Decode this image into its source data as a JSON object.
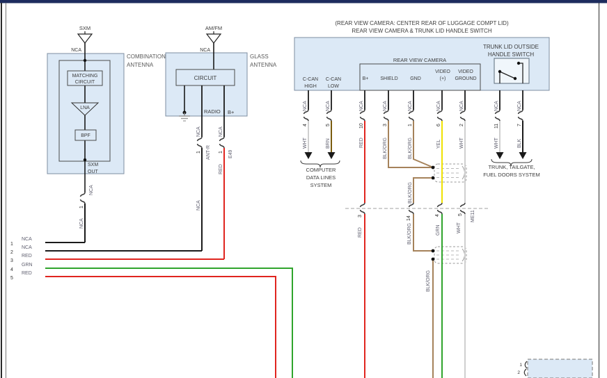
{
  "header": {
    "line1": "(REAR VIEW CAMERA: CENTER REAR OF LUGGAGE COMPT LID)",
    "line2": "REAR VIEW CAMERA & TRUNK LID HANDLE SWITCH"
  },
  "combo": {
    "name1": "COMBINATION",
    "name2": "ANTENNA",
    "antenna": "SXM",
    "antenna_wire": "NCA",
    "matching1": "MATCHING",
    "matching2": "CIRCUIT",
    "lna": "LNA",
    "bpf": "BPF",
    "out1": "SXM",
    "out2": "OUT",
    "drop_upper": "NCA",
    "drop_pin": "1",
    "drop_lower": "NCA"
  },
  "glass": {
    "name1": "GLASS",
    "name2": "ANTENNA",
    "antenna": "AM/FM",
    "antenna_wire": "NCA",
    "circuit": "CIRCUIT",
    "radio_pin": "RADIO",
    "bplus_pin": "B+",
    "radio_wire": {
      "upper": "NCA",
      "pin": "1",
      "conn": "ANT-R",
      "lower": "NCA"
    },
    "bplus_wire": {
      "upper": "NCA",
      "pin": "1",
      "conn": "E49",
      "lower": "RED"
    }
  },
  "block": {
    "rvc": "REAR VIEW CAMERA",
    "ccan_high1": "C-CAN",
    "ccan_high2": "HIGH",
    "ccan_low1": "C-CAN",
    "ccan_low2": "LOW",
    "bplus": "B+",
    "shield": "SHIELD",
    "gnd": "GND",
    "video1": "VIDEO",
    "video2": "(+)",
    "vgnd1": "VIDEO",
    "vgnd2": "GROUND",
    "switch1": "TRUNK LID OUTSIDE",
    "switch2": "HANDLE SWITCH"
  },
  "cols": [
    {
      "top": "NCA",
      "pin": "4",
      "color": "WHT"
    },
    {
      "top": "NCA",
      "pin": "5",
      "color": "BRN"
    },
    {
      "top": "NCA",
      "pin": "10",
      "color": "RED"
    },
    {
      "top": "NCA",
      "pin": "3",
      "color": "BLK/ORG"
    },
    {
      "top": "NCA",
      "pin": "1",
      "color": "BLK/ORG"
    },
    {
      "top": "NCA",
      "pin": "6",
      "color": "YEL"
    },
    {
      "top": "NCA",
      "pin": "2",
      "color": "WHT"
    },
    {
      "top": "NCA",
      "pin": "11",
      "color": "WHT"
    },
    {
      "top": "NCA",
      "pin": "7",
      "color": "BLK"
    }
  ],
  "systems": {
    "computer1": "COMPUTER",
    "computer2": "DATA LINES",
    "computer3": "SYSTEM",
    "trunk1": "TRUNK, TAILGATE,",
    "trunk2": "FUEL DOORS SYSTEM"
  },
  "me11": {
    "p1": "3",
    "p2": "14",
    "p3": "4",
    "p4": "5",
    "name": "ME11"
  },
  "mid": {
    "blkorg_shield": "BLK/ORG",
    "red": "RED",
    "blkorg_mid": "BLK/ORG",
    "grn": "GRN",
    "wht": "WHT",
    "blkorg_low": "BLK/ORG"
  },
  "bus": [
    {
      "num": "1",
      "label": "NCA"
    },
    {
      "num": "2",
      "label": "NCA"
    },
    {
      "num": "3",
      "label": "RED"
    },
    {
      "num": "4",
      "label": "GRN"
    },
    {
      "num": "5",
      "label": "RED"
    }
  ],
  "bottom": {
    "p1": "1",
    "p2": "2"
  },
  "colors": {
    "red": "#e0241e",
    "green": "#2fa42c",
    "yellow": "#efe202",
    "brown": "#7a5c0e",
    "blk_org": "#a5825a",
    "white_wire": "#cfcfcf",
    "black_wire": "#1a1a1a",
    "block_fill": "#dce9f6",
    "block_stroke": "#7d8da0",
    "frame_bar": "#1d2c5e"
  }
}
